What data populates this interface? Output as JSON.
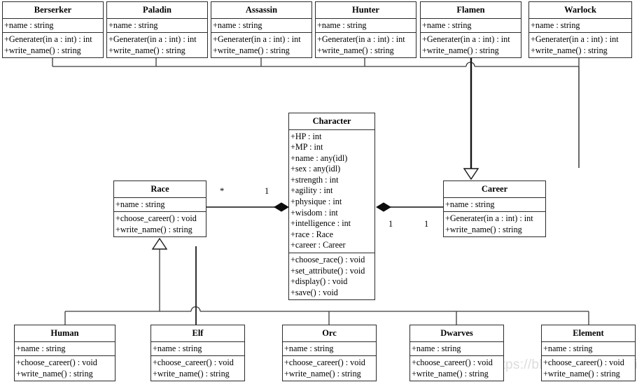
{
  "diagram": {
    "title": "Character Race and Career UML Class Diagram",
    "watermark": "https://blog.csdn.net/weixin_43681295",
    "line_color": "#3a3a3a",
    "box_border_color": "#2b2b2b",
    "background": "#ffffff"
  },
  "careers": [
    {
      "name": "Berserker",
      "attributes": [
        "+name : string"
      ],
      "operations": [
        "+Generater(in a : int) : int",
        "+write_name() : string"
      ]
    },
    {
      "name": "Paladin",
      "attributes": [
        "+name : string"
      ],
      "operations": [
        "+Generater(in a : int) : int",
        "+write_name() : string"
      ]
    },
    {
      "name": "Assassin",
      "attributes": [
        "+name : string"
      ],
      "operations": [
        "+Generater(in a : int) : int",
        "+write_name() : string"
      ]
    },
    {
      "name": "Hunter",
      "attributes": [
        "+name : string"
      ],
      "operations": [
        "+Generater(in a : int) : int",
        "+write_name() : string"
      ]
    },
    {
      "name": "Flamen",
      "attributes": [
        "+name : string"
      ],
      "operations": [
        "+Generater(in a : int) : int",
        "+write_name() : string"
      ]
    },
    {
      "name": "Warlock",
      "attributes": [
        "+name : string"
      ],
      "operations": [
        "+Generater(in a : int) : int",
        "+write_name() : string"
      ]
    }
  ],
  "character": {
    "name": "Character",
    "attributes": [
      "+HP : int",
      "+MP : int",
      "+name : any(idl)",
      "+sex : any(idl)",
      "+strength : int",
      "+agility : int",
      "+physique : int",
      "+wisdom : int",
      "+intelligence : int",
      "+race : Race",
      "+career : Career"
    ],
    "operations": [
      "+choose_race() : void",
      "+set_attribute() : void",
      "+display() : void",
      "+save() : void"
    ]
  },
  "race": {
    "name": "Race",
    "attributes": [
      "+name : string"
    ],
    "operations": [
      "+choose_career() : void",
      "+write_name() : string"
    ]
  },
  "career_base": {
    "name": "Career",
    "attributes": [
      "+name : string"
    ],
    "operations": [
      "+Generater(in a : int) : int",
      "+write_name() : string"
    ]
  },
  "races": [
    {
      "name": "Human",
      "attributes": [
        "+name : string"
      ],
      "operations": [
        "+choose_career() : void",
        "+write_name() : string"
      ]
    },
    {
      "name": "Elf",
      "attributes": [
        "+name : string"
      ],
      "operations": [
        "+choose_career() : void",
        "+write_name() : string"
      ]
    },
    {
      "name": "Orc",
      "attributes": [
        "+name : string"
      ],
      "operations": [
        "+choose_career() : void",
        "+write_name() : string"
      ]
    },
    {
      "name": "Dwarves",
      "attributes": [
        "+name : string"
      ],
      "operations": [
        "+choose_career() : void",
        "+write_name() : string"
      ]
    },
    {
      "name": "Element",
      "attributes": [
        "+name : string"
      ],
      "operations": [
        "+choose_career() : void",
        "+write_name() : string"
      ]
    }
  ],
  "multiplicities": {
    "race_side": "*",
    "character_left": "1",
    "character_right": "1",
    "career_side": "1"
  }
}
